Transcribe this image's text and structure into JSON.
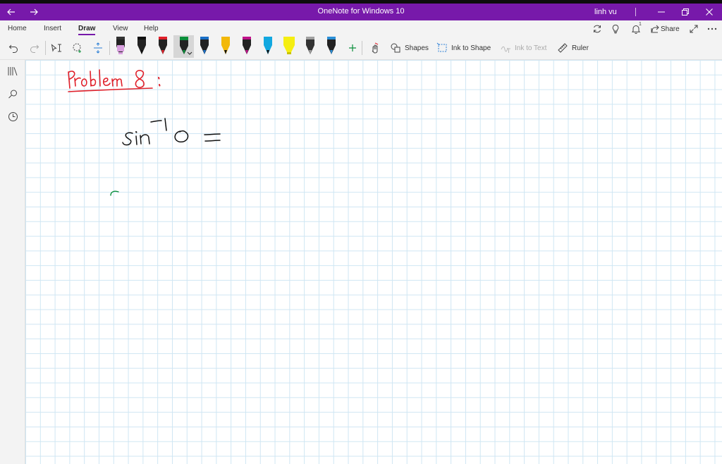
{
  "titlebar": {
    "title": "OneNote for Windows 10",
    "user": "linh vu",
    "back_icon": "arrow-left-icon",
    "forward_icon": "arrow-right-icon",
    "color": "#7719aa"
  },
  "ribbon": {
    "tabs": [
      {
        "label": "Home"
      },
      {
        "label": "Insert"
      },
      {
        "label": "Draw"
      },
      {
        "label": "View"
      },
      {
        "label": "Help"
      }
    ],
    "active_tab": "Draw",
    "share_label": "Share",
    "notification_count": "1",
    "shapes_label": "Shapes",
    "ink_to_shape_label": "Ink to Shape",
    "ink_to_text_label": "Ink to Text",
    "ruler_label": "Ruler",
    "pens": [
      {
        "color": "#d9a0e0",
        "type": "highlighter"
      },
      {
        "color": "#111111",
        "type": "pen"
      },
      {
        "color": "#e0202a",
        "type": "pen"
      },
      {
        "color": "#0a8f3a",
        "type": "pen",
        "selected": true
      },
      {
        "color": "#1a6fc6",
        "type": "pen"
      },
      {
        "color": "#f2b80a",
        "type": "pen"
      },
      {
        "color": "#c0128a",
        "type": "pen"
      },
      {
        "color": "#12a8e0",
        "type": "pen"
      },
      {
        "color": "#f5ee12",
        "type": "highlighter"
      },
      {
        "color": "#a0a0a0",
        "type": "pencil"
      },
      {
        "color": "#2b8fd6",
        "type": "pen"
      }
    ]
  },
  "page": {
    "ink_colors": {
      "heading": "#e0202a",
      "math": "#111111",
      "partial": "#0a8f3a"
    }
  }
}
